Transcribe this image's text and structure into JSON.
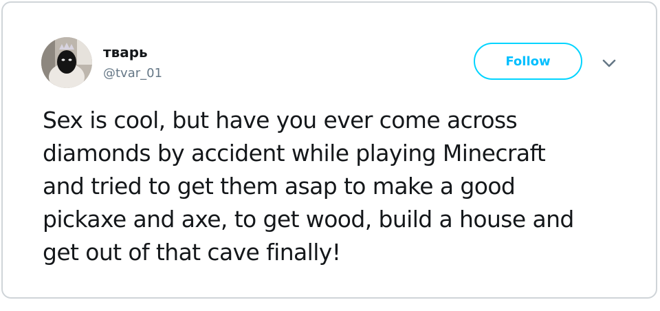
{
  "tweet": {
    "user": {
      "display_name": "тварь",
      "handle": "@tvar_01",
      "avatar_icon": "profile-photo"
    },
    "follow_label": "Follow",
    "menu_icon": "chevron-down-icon",
    "text": "Sex is cool, but have you ever come across diamonds by accident while playing Minecraft and tried to get them asap to make a good pickaxe and axe, to get wood, build a house and get out of that cave finally!"
  },
  "colors": {
    "accent": "#1da1f2",
    "text_primary": "#14171a",
    "text_secondary": "#657786",
    "border": "#cfd4d8"
  }
}
